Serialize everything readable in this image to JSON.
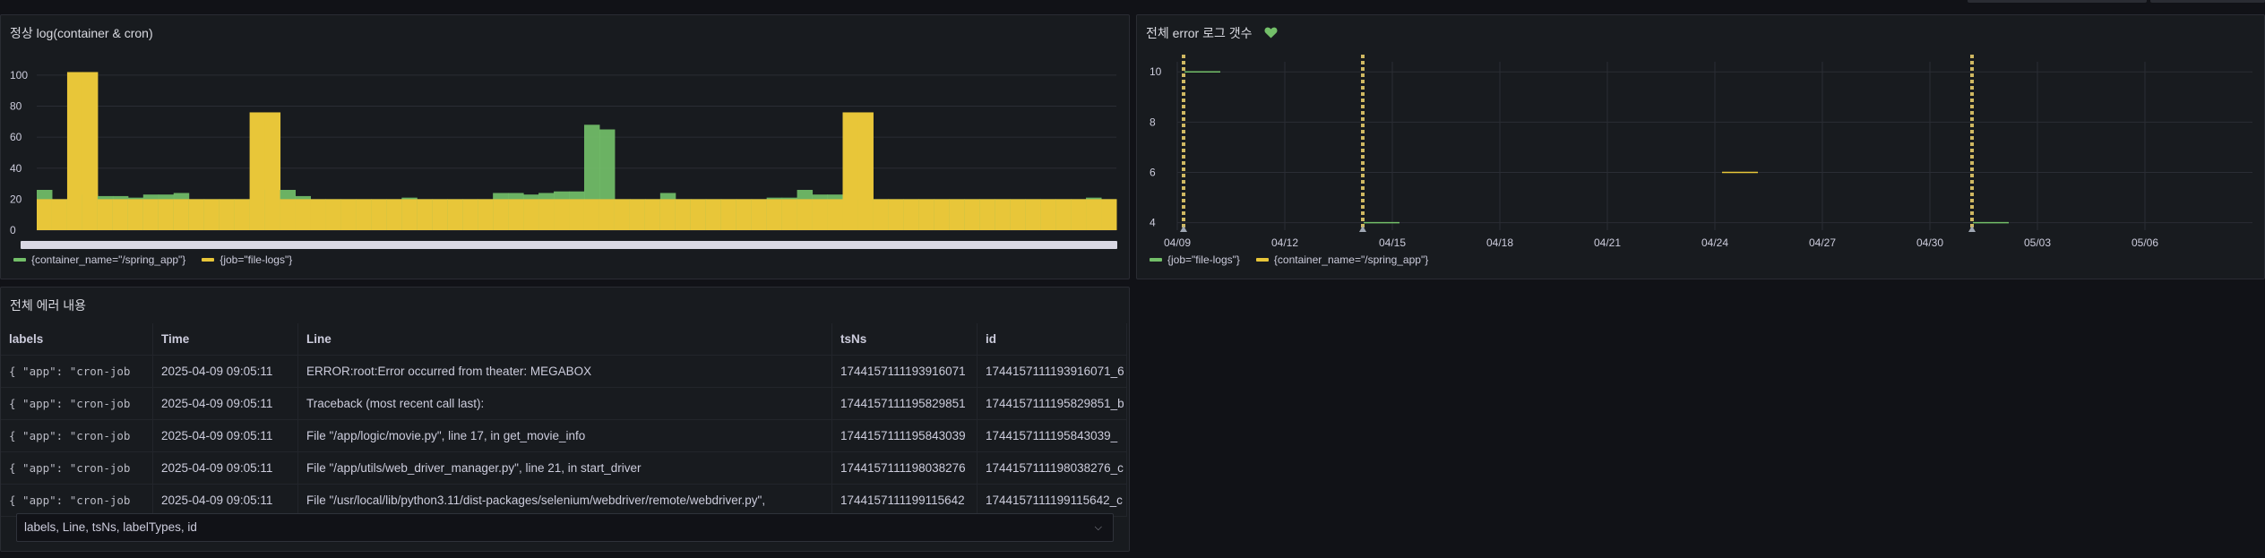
{
  "colors": {
    "green": "#73bf69",
    "yellow": "#e8c639",
    "grid": "#2a2d34",
    "text": "#ccccdc"
  },
  "panel_left": {
    "title": "정상 log(container & cron)",
    "legend": [
      {
        "label": "{container_name=\"/spring_app\"}",
        "color": "#73bf69"
      },
      {
        "label": "{job=\"file-logs\"}",
        "color": "#e8c639"
      }
    ]
  },
  "panel_right": {
    "title": "전체 error 로그 갯수",
    "title_icon": "heart-icon",
    "legend": [
      {
        "label": "{job=\"file-logs\"}",
        "color": "#73bf69"
      },
      {
        "label": "{container_name=\"/spring_app\"}",
        "color": "#e8c639"
      }
    ]
  },
  "panel_table": {
    "title": "전체 에러 내용",
    "columns": [
      "labels",
      "Time",
      "Line",
      "tsNs",
      "id"
    ],
    "rows": [
      {
        "labels": "{ \"app\": \"cron-job",
        "time": "2025-04-09 09:05:11",
        "line": "ERROR:root:Error occurred from theater: MEGABOX",
        "tsns": "1744157111193916071",
        "id": "1744157111193916071_6"
      },
      {
        "labels": "{ \"app\": \"cron-job",
        "time": "2025-04-09 09:05:11",
        "line": "Traceback (most recent call last):",
        "tsns": "1744157111195829851",
        "id": "1744157111195829851_b"
      },
      {
        "labels": "{ \"app\": \"cron-job",
        "time": "2025-04-09 09:05:11",
        "line": "File \"/app/logic/movie.py\", line 17, in get_movie_info",
        "tsns": "1744157111195843039",
        "id": "1744157111195843039_"
      },
      {
        "labels": "{ \"app\": \"cron-job",
        "time": "2025-04-09 09:05:11",
        "line": "File \"/app/utils/web_driver_manager.py\", line 21, in start_driver",
        "tsns": "1744157111198038276",
        "id": "1744157111198038276_c"
      },
      {
        "labels": "{ \"app\": \"cron-job",
        "time": "2025-04-09 09:05:11",
        "line": "File \"/usr/local/lib/python3.11/dist-packages/selenium/webdriver/remote/webdriver.py\",",
        "tsns": "1744157111199115642",
        "id": "1744157111199115642_c"
      }
    ],
    "field_select_value": "labels, Line, tsNs, labelTypes, id"
  },
  "chart_data": [
    {
      "type": "bar",
      "title": "정상 log(container & cron)",
      "ylim": [
        0,
        100
      ],
      "yticks": [
        0,
        20,
        40,
        60,
        80,
        100
      ],
      "grid": true,
      "legend_position": "bottom-left",
      "bar_count": 71,
      "series": [
        {
          "name": "{container_name=\"/spring_app\"}",
          "color": "#73bf69",
          "values": [
            26,
            20,
            20,
            23,
            22,
            22,
            21,
            23,
            23,
            24,
            20,
            20,
            20,
            20,
            20,
            26,
            26,
            22,
            20,
            20,
            20,
            20,
            20,
            20,
            21,
            20,
            20,
            20,
            20,
            20,
            24,
            24,
            23,
            24,
            25,
            25,
            68,
            65,
            20,
            20,
            20,
            24,
            20,
            20,
            20,
            20,
            20,
            20,
            21,
            21,
            26,
            23,
            23,
            20,
            20,
            20,
            20,
            20,
            20,
            20,
            20,
            20,
            20,
            20,
            20,
            20,
            20,
            20,
            20,
            21,
            20
          ]
        },
        {
          "name": "{job=\"file-logs\"}",
          "color": "#e8c639",
          "values": [
            20,
            20,
            102,
            102,
            20,
            20,
            20,
            20,
            20,
            20,
            20,
            20,
            20,
            20,
            76,
            76,
            20,
            20,
            20,
            20,
            20,
            20,
            20,
            20,
            20,
            20,
            20,
            20,
            20,
            20,
            20,
            20,
            20,
            20,
            20,
            20,
            20,
            20,
            20,
            20,
            20,
            20,
            20,
            20,
            20,
            20,
            20,
            20,
            20,
            20,
            20,
            20,
            20,
            76,
            76,
            20,
            20,
            20,
            20,
            20,
            20,
            20,
            20,
            20,
            20,
            20,
            20,
            20,
            20,
            20,
            20
          ]
        }
      ]
    },
    {
      "type": "line",
      "title": "전체 error 로그 갯수",
      "x_tick_labels": [
        "04/09",
        "04/12",
        "04/15",
        "04/18",
        "04/21",
        "04/24",
        "04/27",
        "04/30",
        "05/03",
        "05/06"
      ],
      "x_range": [
        "04/09",
        "05/09"
      ],
      "ylim": [
        3.7,
        10.4
      ],
      "yticks": [
        4,
        6,
        8,
        10
      ],
      "grid": true,
      "legend_position": "bottom-left",
      "annotation_dates": [
        "04/09",
        "04/14",
        "05/01"
      ],
      "series": [
        {
          "name": "{job=\"file-logs\"}",
          "color": "#73bf69",
          "segments": [
            {
              "x_start": "04/09",
              "x_end": "04/10",
              "y": 10
            },
            {
              "x_start": "04/14",
              "x_end": "04/15",
              "y": 4
            },
            {
              "x_start": "05/01",
              "x_end": "05/02",
              "y": 4
            }
          ]
        },
        {
          "name": "{container_name=\"/spring_app\"}",
          "color": "#e8c639",
          "segments": [
            {
              "x_start": "04/24",
              "x_end": "04/25",
              "y": 6
            }
          ]
        }
      ]
    }
  ]
}
